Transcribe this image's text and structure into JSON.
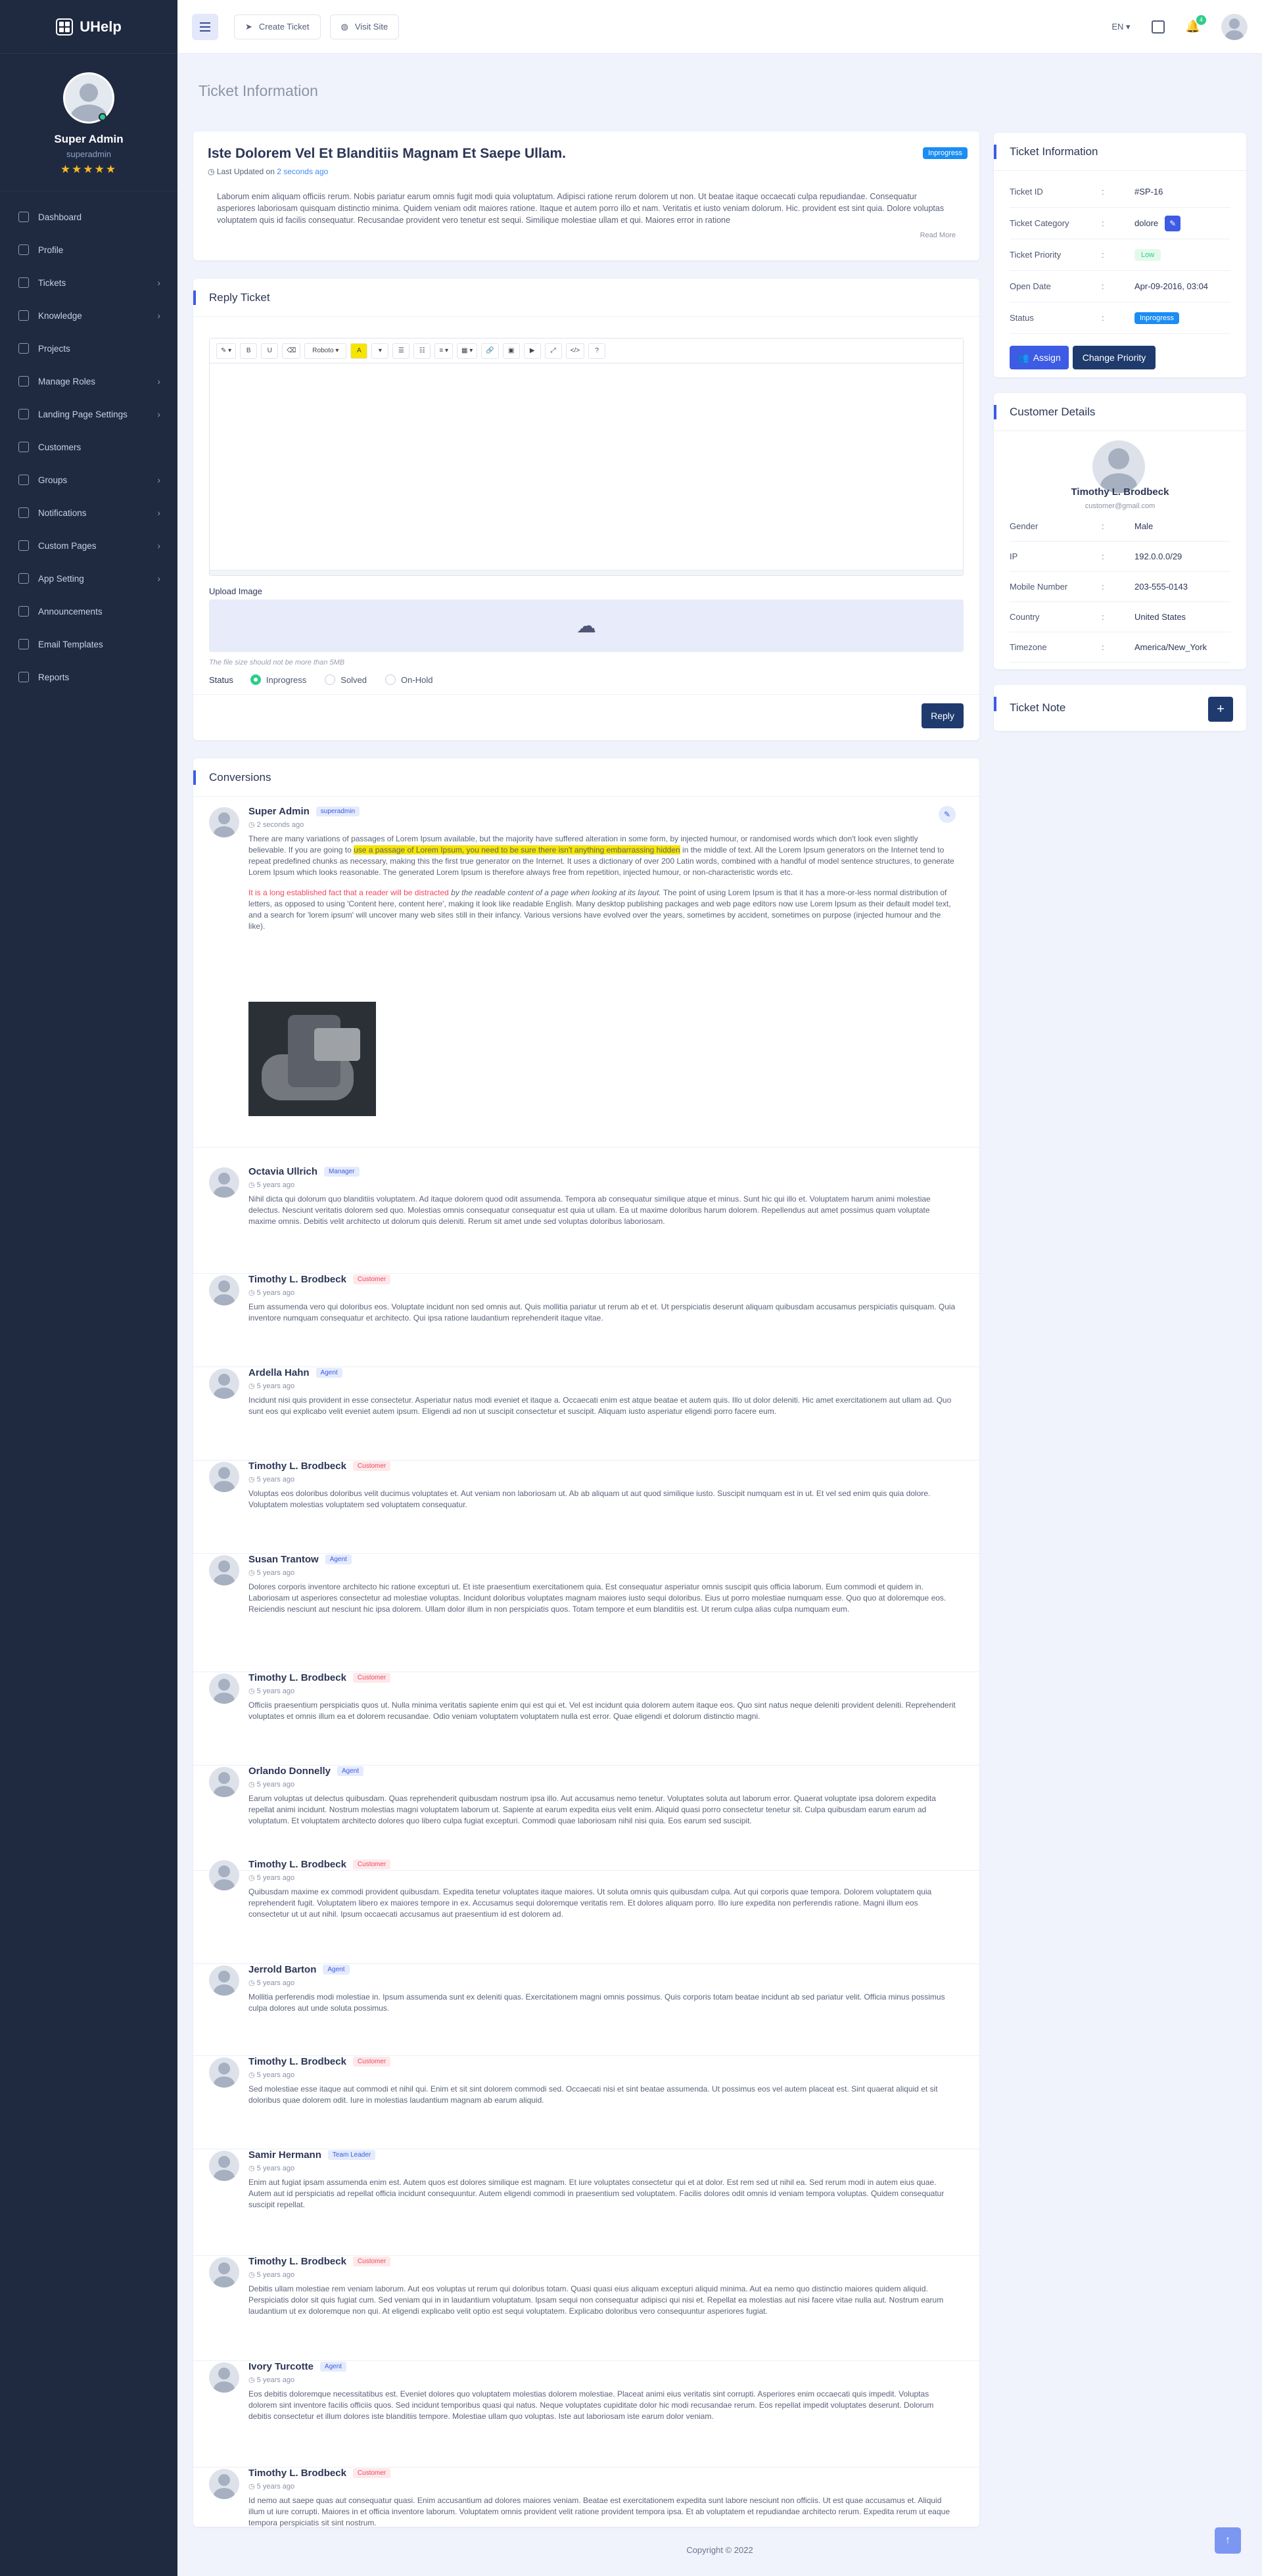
{
  "brand": {
    "name": "UHelp"
  },
  "user": {
    "name": "Super Admin",
    "role": "superadmin",
    "stars": "★★★★★"
  },
  "sidebar": {
    "items": [
      {
        "label": "Dashboard",
        "chev": ""
      },
      {
        "label": "Profile",
        "chev": ""
      },
      {
        "label": "Tickets",
        "chev": "›"
      },
      {
        "label": "Knowledge",
        "chev": "›"
      },
      {
        "label": "Projects",
        "chev": ""
      },
      {
        "label": "Manage Roles",
        "chev": "›"
      },
      {
        "label": "Landing Page Settings",
        "chev": "›"
      },
      {
        "label": "Customers",
        "chev": ""
      },
      {
        "label": "Groups",
        "chev": "›"
      },
      {
        "label": "Notifications",
        "chev": "›"
      },
      {
        "label": "Custom Pages",
        "chev": "›"
      },
      {
        "label": "App Setting",
        "chev": "›"
      },
      {
        "label": "Announcements",
        "chev": ""
      },
      {
        "label": "Email Templates",
        "chev": ""
      },
      {
        "label": "Reports",
        "chev": ""
      }
    ]
  },
  "topbar": {
    "create_ticket": "Create Ticket",
    "visit_site": "Visit Site",
    "lang": "EN ▾",
    "notif_count": "4"
  },
  "page": {
    "title": "Ticket Information"
  },
  "ticket": {
    "title": "Iste Dolorem Vel Et Blanditiis Magnam Et Saepe Ullam.",
    "status": "Inprogress",
    "updated_prefix": "Last Updated on",
    "updated_value": "2 seconds ago",
    "body": "Laborum enim aliquam officiis rerum. Nobis pariatur earum omnis fugit modi quia voluptatum. Adipisci ratione rerum dolorem ut non. Ut beatae itaque occaecati culpa repudiandae. Consequatur asperiores laboriosam quisquam distinctio minima. Quidem veniam odit maiores ratione. Itaque et autem porro illo et nam. Veritatis et iusto veniam dolorum. Hic. provident est sint quia. Dolore voluptas voluptatem quis id facilis consequatur. Recusandae provident vero tenetur est sequi. Similique molestiae ullam et qui. Maiores error in ratione",
    "read_more": "Read More"
  },
  "info": {
    "title": "Ticket Information",
    "rows": [
      {
        "k": "Ticket ID",
        "v": "#SP-16"
      },
      {
        "k": "Ticket Category",
        "v": "dolore"
      },
      {
        "k": "Ticket Priority",
        "v": "Low"
      },
      {
        "k": "Open Date",
        "v": "Apr-09-2016, 03:04"
      },
      {
        "k": "Status",
        "v": "Inprogress"
      }
    ],
    "assign": "Assign",
    "change_priority": "Change Priority"
  },
  "customer": {
    "title": "Customer Details",
    "name": "Timothy L. Brodbeck",
    "email": "customer@gmail.com",
    "rows": [
      {
        "k": "Gender",
        "v": "Male"
      },
      {
        "k": "IP",
        "v": "192.0.0.0/29"
      },
      {
        "k": "Mobile Number",
        "v": "203-555-0143"
      },
      {
        "k": "Country",
        "v": "United States"
      },
      {
        "k": "Timezone",
        "v": "America/New_York"
      }
    ]
  },
  "note": {
    "title": "Ticket Note",
    "add": "+"
  },
  "reply": {
    "title": "Reply Ticket",
    "toolbar": [
      "✎ ▾",
      "B",
      "U",
      "⌫",
      "Roboto ▾",
      "A",
      "▾",
      "☰",
      "☷",
      "≡ ▾",
      "▦ ▾",
      "🔗",
      "▣",
      "▶",
      "⤢",
      "</>",
      "?"
    ],
    "upload_label": "Upload Image",
    "upload_hint": "The file size should not be more than 5MB",
    "status_label": "Status",
    "options": [
      "Inprogress",
      "Solved",
      "On-Hold"
    ],
    "submit": "Reply"
  },
  "conversations": {
    "title": "Conversions",
    "first": {
      "name": "Super Admin",
      "role": "superadmin",
      "time": "2 seconds ago",
      "p1_a": "There are many variations of passages of Lorem Ipsum available, but the majority have suffered alteration in some form, by injected humour, or randomised words which don't look even slightly believable. If you are going to ",
      "p1_mark": "use a passage of Lorem Ipsum, you need to be sure there isn't anything embarrassing hidden",
      "p1_b": " in the middle of text. All the Lorem Ipsum generators on the Internet tend to repeat predefined chunks as necessary, making this the first true generator on the Internet. It uses a dictionary of over 200 Latin words, combined with a handful of model sentence structures, to generate Lorem Ipsum which looks reasonable. The generated Lorem Ipsum is therefore always free from repetition, injected humour, or non-characteristic words etc.",
      "p2_red": "It is a long established fact that a reader will be distracted",
      "p2_italic": " by the readable content of a page when looking at its layout.",
      "p2_b": " The point of using Lorem Ipsum is that it has a more-or-less normal distribution of letters, as opposed to using 'Content here, content here', making it look like readable English. Many desktop publishing packages and web page editors now use Lorem Ipsum as their default model text, and a search for 'lorem ipsum' will uncover many web sites still in their infancy. Various versions have evolved over the years, sometimes by accident, sometimes on purpose (injected humour and the like)."
    },
    "items": [
      {
        "name": "Octavia Ullrich",
        "role": "Manager",
        "rtype": "blue",
        "time": "5 years ago",
        "text": "Nihil dicta qui dolorum quo blanditiis voluptatem. Ad itaque dolorem quod odit assumenda. Tempora ab consequatur similique atque et minus. Sunt hic qui illo et. Voluptatem harum animi molestiae delectus. Nesciunt veritatis dolorem sed quo. Molestias omnis consequatur consequatur est quia ut ullam. Ea ut maxime doloribus harum dolorem. Repellendus aut amet possimus quam voluptate maxime omnis. Debitis velit architecto ut dolorum quis deleniti. Rerum sit amet unde sed voluptas doloribus laboriosam."
      },
      {
        "name": "Timothy L. Brodbeck",
        "role": "Customer",
        "rtype": "red",
        "time": "5 years ago",
        "text": "Eum assumenda vero qui doloribus eos. Voluptate incidunt non sed omnis aut. Quis mollitia pariatur ut rerum ab et et. Ut perspiciatis deserunt aliquam quibusdam accusamus perspiciatis quisquam. Quia inventore numquam consequatur et architecto. Qui ipsa ratione laudantium reprehenderit itaque vitae."
      },
      {
        "name": "Ardella Hahn",
        "role": "Agent",
        "rtype": "blue",
        "time": "5 years ago",
        "text": "Incidunt nisi quis provident in esse consectetur. Asperiatur natus modi eveniet et itaque a. Occaecati enim est atque beatae et autem quis. Illo ut dolor deleniti. Hic amet exercitationem aut ullam ad. Quo sunt eos qui explicabo velit eveniet autem ipsum. Eligendi ad non ut suscipit consectetur et suscipit. Aliquam iusto asperiatur eligendi porro facere eum."
      },
      {
        "name": "Timothy L. Brodbeck",
        "role": "Customer",
        "rtype": "red",
        "time": "5 years ago",
        "text": "Voluptas eos doloribus doloribus velit ducimus voluptates et. Aut veniam non laboriosam ut. Ab ab aliquam ut aut quod similique iusto. Suscipit numquam est in ut. Et vel sed enim quis quia dolore. Voluptatem molestias voluptatem sed voluptatem consequatur."
      },
      {
        "name": "Susan Trantow",
        "role": "Agent",
        "rtype": "blue",
        "time": "5 years ago",
        "text": "Dolores corporis inventore architecto hic ratione excepturi ut. Et iste praesentium exercitationem quia. Est consequatur asperiatur omnis suscipit quis officia laborum. Eum commodi et quidem in. Laboriosam ut asperiores consectetur ad molestiae voluptas. Incidunt doloribus voluptates magnam maiores iusto sequi doloribus. Eius ut porro molestiae numquam esse. Quo quo at doloremque eos. Reiciendis nesciunt aut nesciunt hic ipsa dolorem. Ullam dolor illum in non perspiciatis quos. Totam tempore et eum blanditiis est. Ut rerum culpa alias culpa numquam eum."
      },
      {
        "name": "Timothy L. Brodbeck",
        "role": "Customer",
        "rtype": "red",
        "time": "5 years ago",
        "text": "Officiis praesentium perspiciatis quos ut. Nulla minima veritatis sapiente enim qui est qui et. Vel est incidunt quia dolorem autem itaque eos. Quo sint natus neque deleniti provident deleniti. Reprehenderit voluptates et omnis illum ea et dolorem recusandae. Odio veniam voluptatem voluptatem nulla est error. Quae eligendi et dolorum distinctio magni."
      },
      {
        "name": "Orlando Donnelly",
        "role": "Agent",
        "rtype": "blue",
        "time": "5 years ago",
        "text": "Earum voluptas ut delectus quibusdam. Quas reprehenderit quibusdam nostrum ipsa illo. Aut accusamus nemo tenetur. Voluptates soluta aut laborum error. Quaerat voluptate ipsa dolorem expedita repellat animi incidunt. Nostrum molestias magni voluptatem laborum ut. Sapiente at earum expedita eius velit enim. Aliquid quasi porro consectetur tenetur sit. Culpa quibusdam earum earum ad voluptatum. Et voluptatem architecto dolores quo libero culpa fugiat excepturi. Commodi quae laboriosam nihil nisi quia. Eos earum sed suscipit."
      },
      {
        "name": "Timothy L. Brodbeck",
        "role": "Customer",
        "rtype": "red",
        "time": "5 years ago",
        "text": "Quibusdam maxime ex commodi provident quibusdam. Expedita tenetur voluptates itaque maiores. Ut soluta omnis quis quibusdam culpa. Aut qui corporis quae tempora. Dolorem voluptatem quia reprehenderit fugit. Voluptatem libero ex maiores tempore in ex. Accusamus sequi doloremque veritatis rem. Et dolores aliquam porro. Illo iure expedita non perferendis ratione. Magni illum eos consectetur ut ut aut nihil. Ipsum occaecati accusamus aut praesentium id est dolorem ad."
      },
      {
        "name": "Jerrold Barton",
        "role": "Agent",
        "rtype": "blue",
        "time": "5 years ago",
        "text": "Mollitia perferendis modi molestiae in. Ipsum assumenda sunt ex deleniti quas. Exercitationem magni omnis possimus. Quis corporis totam beatae incidunt ab sed pariatur velit. Officia minus possimus culpa dolores aut unde soluta possimus."
      },
      {
        "name": "Timothy L. Brodbeck",
        "role": "Customer",
        "rtype": "red",
        "time": "5 years ago",
        "text": "Sed molestiae esse itaque aut commodi et nihil qui. Enim et sit sint dolorem commodi sed. Occaecati nisi et sint beatae assumenda. Ut possimus eos vel autem placeat est. Sint quaerat aliquid et sit doloribus quae dolorem odit. Iure in molestias laudantium magnam ab earum aliquid."
      },
      {
        "name": "Samir Hermann",
        "role": "Team Leader",
        "rtype": "blue",
        "time": "5 years ago",
        "text": "Enim aut fugiat ipsam assumenda enim est. Autem quos est dolores similique est magnam. Et iure voluptates consectetur qui et at dolor. Est rem sed ut nihil ea. Sed rerum modi in autem eius quae. Autem aut id perspiciatis ad repellat officia incidunt consequuntur. Autem eligendi commodi in praesentium sed voluptatem. Facilis dolores odit omnis id veniam tempora voluptas. Quidem consequatur suscipit repellat."
      },
      {
        "name": "Timothy L. Brodbeck",
        "role": "Customer",
        "rtype": "red",
        "time": "5 years ago",
        "text": "Debitis ullam molestiae rem veniam laborum. Aut eos voluptas ut rerum qui doloribus totam. Quasi quasi eius aliquam excepturi aliquid minima. Aut ea nemo quo distinctio maiores quidem aliquid. Perspiciatis dolor sit quis fugiat cum. Sed veniam qui in in laudantium voluptatum. Ipsam sequi non consequatur adipisci qui nisi et. Repellat ea molestias aut nisi facere vitae nulla aut. Nostrum earum laudantium ut ex doloremque non qui. At eligendi explicabo velit optio est sequi voluptatem. Explicabo doloribus vero consequuntur asperiores fugiat."
      },
      {
        "name": "Ivory Turcotte",
        "role": "Agent",
        "rtype": "blue",
        "time": "5 years ago",
        "text": "Eos debitis doloremque necessitatibus est. Eveniet dolores quo voluptatem molestias dolorem molestiae. Placeat animi eius veritatis sint corrupti. Asperiores enim occaecati quis impedit. Voluptas dolorem sint inventore facilis officiis quos. Sed incidunt temporibus quasi qui natus. Neque voluptates cupiditate dolor hic modi recusandae rerum. Eos repellat impedit voluptates deserunt. Dolorum debitis consectetur et illum dolores iste blanditiis tempore. Molestiae ullam quo voluptas. Iste aut laboriosam iste earum dolor veniam."
      },
      {
        "name": "Timothy L. Brodbeck",
        "role": "Customer",
        "rtype": "red",
        "time": "5 years ago",
        "text": "Id nemo aut saepe quas aut consequatur quasi. Enim accusantium ad dolores maiores veniam. Beatae est exercitationem expedita sunt labore nesciunt non officiis. Ut est quae accusamus et. Aliquid illum ut iure corrupti. Maiores in et officia inventore laborum. Voluptatem omnis provident velit ratione provident tempora ipsa. Et ab voluptatem et repudiandae architecto rerum. Expedita rerum ut eaque tempora perspiciatis sit sint nostrum."
      }
    ]
  },
  "footer": {
    "copyright": "Copyright © 2022"
  },
  "colors": {
    "accent": "#3d5be4",
    "sidebar": "#1f2940",
    "success": "#2dce89",
    "danger": "#f0475e",
    "info": "#1b8df3"
  }
}
